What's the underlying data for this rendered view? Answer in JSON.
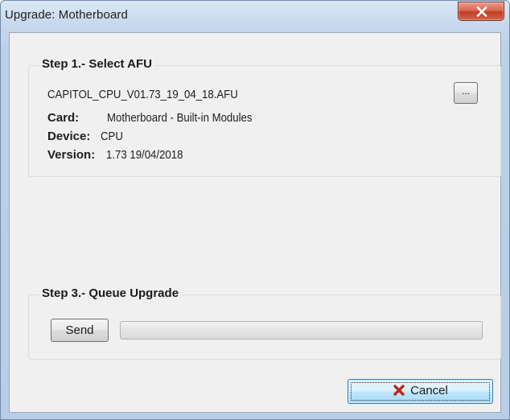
{
  "window": {
    "title": "Upgrade: Motherboard",
    "close_icon": "close-x-icon"
  },
  "step1": {
    "title": "Step 1.- Select AFU",
    "filename": "CAPITOL_CPU_V01.73_19_04_18.AFU",
    "browse_label": "...",
    "card_label": "Card:",
    "card_value": "Motherboard - Built-in Modules",
    "device_label": "Device:",
    "device_value": "CPU",
    "version_label": "Version:",
    "version_value": "1.73 19/04/2018"
  },
  "step3": {
    "title": "Step 3.- Queue Upgrade",
    "send_label": "Send",
    "progress": 0
  },
  "footer": {
    "cancel_label": "Cancel",
    "cancel_icon": "red-x-icon",
    "cancel_icon_color": "#c0281a"
  }
}
